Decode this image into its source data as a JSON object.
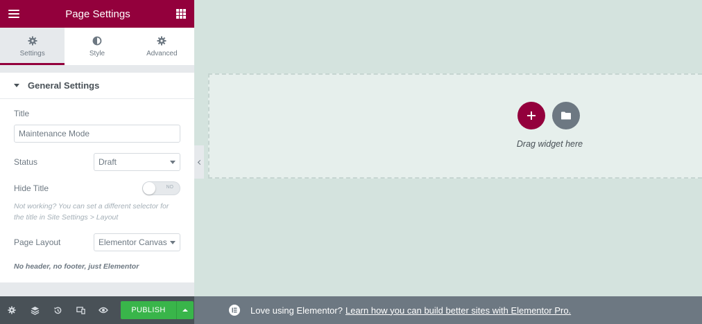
{
  "header": {
    "title": "Page Settings",
    "menu_icon": "hamburger-icon",
    "apps_icon": "grid-icon"
  },
  "tabs": [
    {
      "label": "Settings",
      "icon": "gear-icon",
      "active": true
    },
    {
      "label": "Style",
      "icon": "half-circle-icon",
      "active": false
    },
    {
      "label": "Advanced",
      "icon": "gear-icon",
      "active": false
    }
  ],
  "section": {
    "title": "General Settings"
  },
  "fields": {
    "title_label": "Title",
    "title_value": "Maintenance Mode",
    "status_label": "Status",
    "status_value": "Draft",
    "hide_title_label": "Hide Title",
    "hide_title_toggle": "NO",
    "hide_title_note": "Not working? You can set a different selector for the title in Site Settings > Layout",
    "layout_label": "Page Layout",
    "layout_value": "Elementor Canvas",
    "layout_note": "No header, no footer, just Elementor"
  },
  "canvas": {
    "drop_text": "Drag widget here"
  },
  "footer": {
    "publish_label": "PUBLISH",
    "icons": [
      "settings-icon",
      "layers-icon",
      "history-icon",
      "responsive-icon",
      "preview-icon"
    ]
  },
  "promo": {
    "text": "Love using Elementor?",
    "link": "Learn how you can build better sites with Elementor Pro."
  },
  "colors": {
    "brand": "#93003c",
    "publish": "#39b54a",
    "canvas": "#d4e3de"
  }
}
